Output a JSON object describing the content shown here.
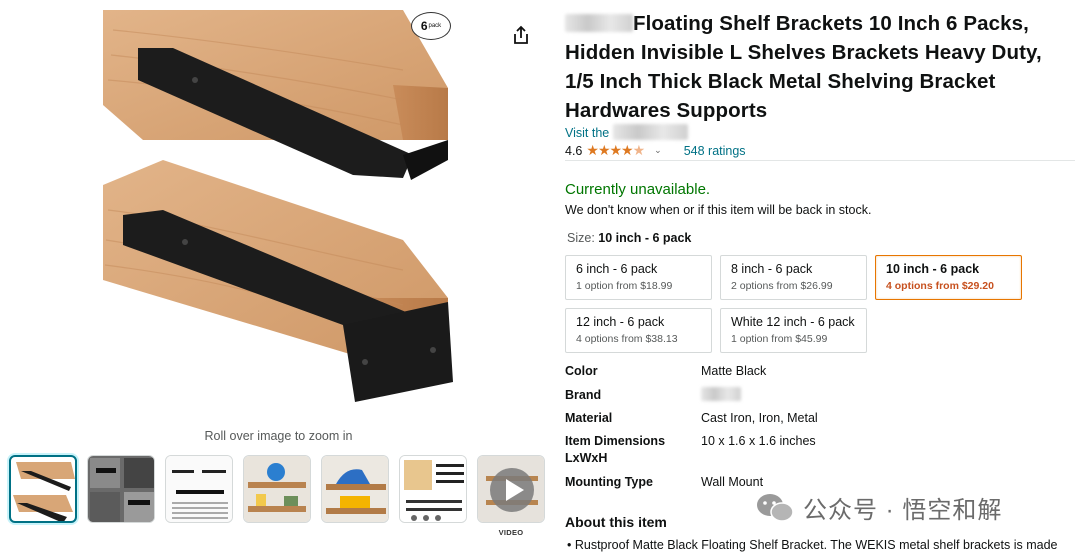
{
  "product": {
    "title": "Floating Shelf Brackets 10 Inch 6 Packs, Hidden Invisible L Shelves Brackets Heavy Duty, 1/5 Inch Thick Black Metal Shelving Bracket Hardwares Supports",
    "store_link_prefix": "Visit the",
    "rating_value": "4.6",
    "rating_stars": 4.6,
    "ratings_count_label": "548 ratings",
    "availability": "Currently unavailable.",
    "stock_note": "We don't know when or if this item will be back in stock.",
    "badge": {
      "number": "6",
      "word": "pack"
    }
  },
  "media": {
    "zoom_hint": "Roll over image to zoom in",
    "video_label": "VIDEO",
    "thumbnails": [
      {
        "kind": "shelf-angle",
        "active": true
      },
      {
        "kind": "bracket-grid"
      },
      {
        "kind": "dimensions-chart"
      },
      {
        "kind": "shelf-with-items"
      },
      {
        "kind": "shelf-with-items-2"
      },
      {
        "kind": "package-contents"
      },
      {
        "kind": "video"
      }
    ]
  },
  "size": {
    "label": "Size:",
    "selected": "10 inch - 6 pack",
    "options": [
      {
        "name": "6 inch - 6 pack",
        "price": "1 option from $18.99",
        "selected": false
      },
      {
        "name": "8 inch - 6 pack",
        "price": "2 options from $26.99",
        "selected": false
      },
      {
        "name": "10 inch - 6 pack",
        "price": "4 options from $29.20",
        "selected": true
      },
      {
        "name": "12 inch - 6 pack",
        "price": "4 options from $38.13",
        "selected": false
      },
      {
        "name": "White 12 inch - 6 pack",
        "price": "1 option from $45.99",
        "selected": false
      }
    ]
  },
  "specs": [
    {
      "key": "Color",
      "value": "Matte Black"
    },
    {
      "key": "Brand",
      "value": ""
    },
    {
      "key": "Material",
      "value": "Cast Iron, Iron, Metal"
    },
    {
      "key": "Item Dimensions LxWxH",
      "value": "10 x 1.6 x 1.6 inches"
    },
    {
      "key": "Mounting Type",
      "value": "Wall Mount"
    }
  ],
  "about": {
    "heading": "About this item",
    "bullets": [
      "Rustproof Matte Black Floating Shelf Bracket. The WEKIS metal shelf brackets is made"
    ]
  },
  "watermark": "公众号 · 悟空和解",
  "colors": {
    "link": "#007185",
    "in_stock_green": "#007600",
    "selected_orange": "#e77600",
    "price_red": "#c7511f",
    "star": "#de7921"
  },
  "icons": [
    "share-icon",
    "play-icon",
    "star-icon",
    "chevron-down-icon",
    "wechat-icon"
  ]
}
